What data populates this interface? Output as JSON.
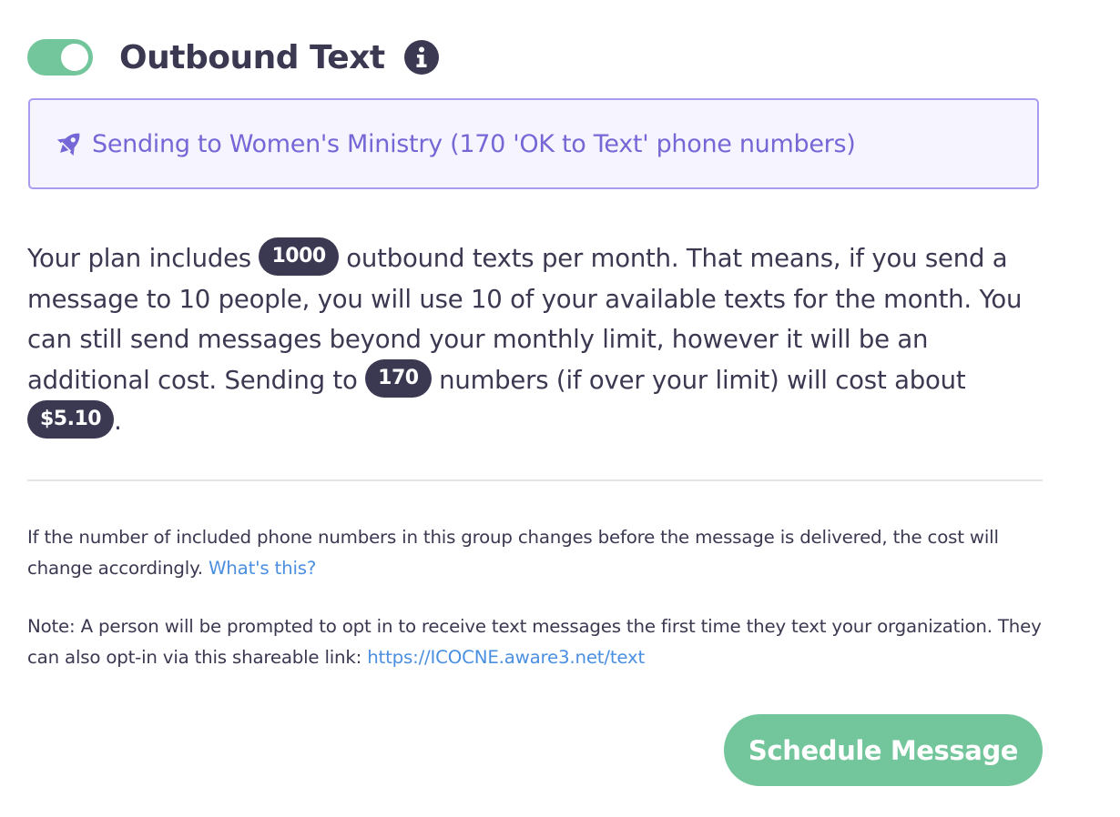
{
  "header": {
    "title": "Outbound Text",
    "toggle_on": true
  },
  "banner": {
    "text": "Sending to Women's Ministry (170 'OK to Text' phone numbers)"
  },
  "plan": {
    "part1": "Your plan includes ",
    "included_texts": "1000",
    "part2": " outbound texts per month. That means, if you send a message to 10 people, you will use 10 of your available texts for the month. You can still send messages beyond your monthly limit, however it will be an additional cost. Sending to ",
    "recipient_count": "170",
    "part3": " numbers (if over your limit) will cost about ",
    "estimated_cost": "$5.10",
    "part4": "."
  },
  "notes": {
    "change_text": "If the number of included phone numbers in this group changes before the message is delivered, the cost will change accordingly. ",
    "whats_this_link": "What's this?",
    "optin_text": "Note: A person will be prompted to opt in to receive text messages the first time they text your organization. They can also opt-in via this shareable link: ",
    "optin_link": "https://ICOCNE.aware3.net/text"
  },
  "actions": {
    "schedule_label": "Schedule Message"
  },
  "colors": {
    "toggle": "#73c69b",
    "primary_text": "#3b3951",
    "banner_border": "#a79cf0",
    "banner_text": "#7567d6",
    "link": "#4b8fe0",
    "button": "#73c69b"
  },
  "icons": {
    "info": "info-circle-icon",
    "rocket": "rocket-icon"
  }
}
